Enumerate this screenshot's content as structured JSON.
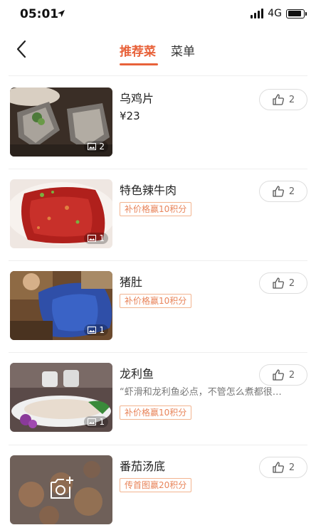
{
  "status": {
    "time": "05:01",
    "network": "4G"
  },
  "nav": {
    "tabs": [
      {
        "label": "推荐菜",
        "active": true
      },
      {
        "label": "菜单",
        "active": false
      }
    ]
  },
  "colors": {
    "accent": "#e8623a",
    "promo_border": "#f2b48f"
  },
  "dishes": [
    {
      "name": "乌鸡片",
      "price": "¥23",
      "photos": "2",
      "likes": "2"
    },
    {
      "name": "特色辣牛肉",
      "promo": "补价格赢10积分",
      "photos": "1",
      "likes": "2"
    },
    {
      "name": "猪肚",
      "promo": "补价格赢10积分",
      "photos": "1",
      "likes": "2"
    },
    {
      "name": "龙利鱼",
      "quote": "“虾滑和龙利鱼必点，不管怎么煮都很…",
      "promo": "补价格赢10积分",
      "photos": "1",
      "likes": "2"
    },
    {
      "name": "番茄汤底",
      "promo": "传首图赢20积分",
      "likes": "2"
    }
  ]
}
